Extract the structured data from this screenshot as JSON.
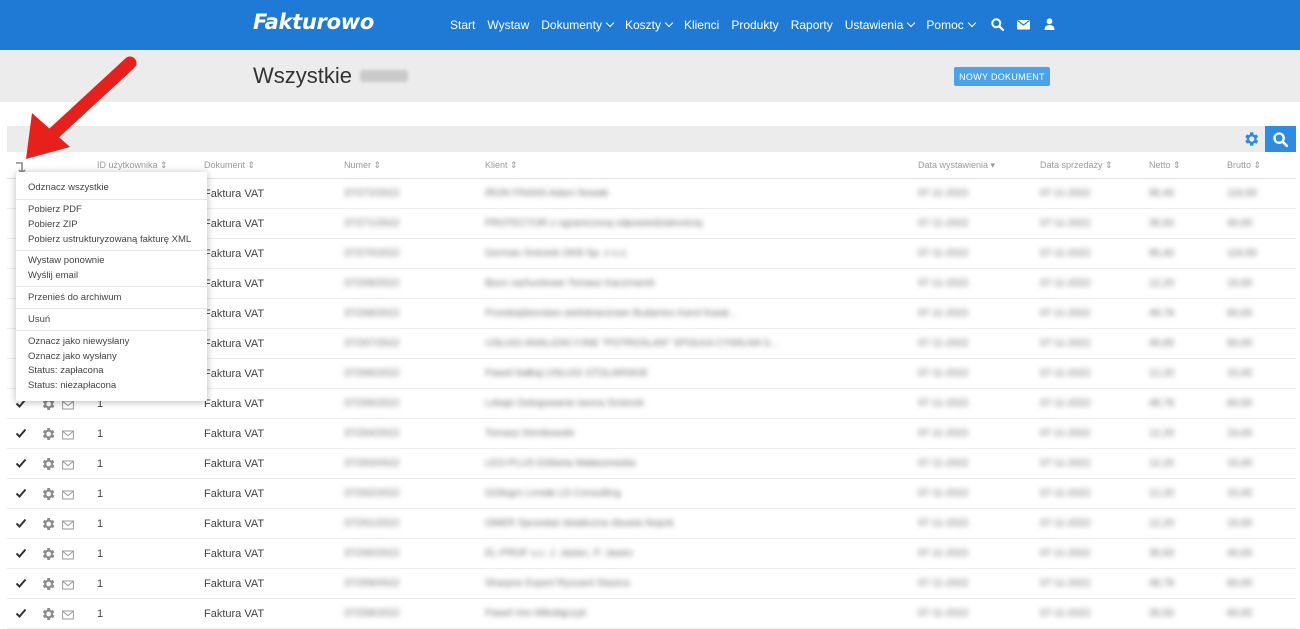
{
  "app": {
    "logo": "Fakturowo",
    "nav": [
      {
        "label": "Start"
      },
      {
        "label": "Wystaw"
      },
      {
        "label": "Dokumenty"
      },
      {
        "label": "Koszty"
      },
      {
        "label": "Klienci"
      },
      {
        "label": "Produkty"
      },
      {
        "label": "Raporty"
      },
      {
        "label": "Ustawienia"
      },
      {
        "label": "Pomoc"
      }
    ]
  },
  "colors": {
    "brand": "#1f7ad6",
    "button": "#4aa3ea",
    "annotation_arrow": "#e8201c"
  },
  "header": {
    "title": "Wszystkie",
    "new_document_label": "NOWY DOKUMENT"
  },
  "table": {
    "columns": [
      "ID użytkownika",
      "Dokument",
      "Numer",
      "Klient",
      "Data wystawienia",
      "Data sprzedaży",
      "Netto",
      "Brutto"
    ],
    "rows": [
      {
        "user_id": "",
        "document": "Faktura VAT",
        "number": "37/272/2022",
        "client": "IRON FRANS Adam Nowak",
        "issue_date": "07-11-2022",
        "sale_date": "07-11-2022",
        "net": "95,40",
        "gross": "116,50"
      },
      {
        "user_id": "",
        "document": "Faktura VAT",
        "number": "37/271/2022",
        "client": "PROTECTOR z ograniczoną odpowiedzialnością",
        "issue_date": "07-11-2022",
        "sale_date": "07-11-2022",
        "net": "35,50",
        "gross": "40,00"
      },
      {
        "user_id": "",
        "document": "Faktura VAT",
        "number": "37/270/2022",
        "client": "German Śnieżek OKB Sp. z o.o.",
        "issue_date": "07-11-2022",
        "sale_date": "07-11-2022",
        "net": "95,40",
        "gross": "116,50"
      },
      {
        "user_id": "",
        "document": "Faktura VAT",
        "number": "37/269/2022",
        "client": "Biuro rachunkowe Tomasz Kaczmarek",
        "issue_date": "07-11-2022",
        "sale_date": "07-11-2022",
        "net": "12,20",
        "gross": "15,00"
      },
      {
        "user_id": "",
        "document": "Faktura VAT",
        "number": "37/268/2022",
        "client": "Przedsiębiorstwo wielobranżowe Budamex Karol Kwiat...",
        "issue_date": "07-11-2022",
        "sale_date": "07-11-2022",
        "net": "48,78",
        "gross": "60,00"
      },
      {
        "user_id": "",
        "document": "Faktura VAT",
        "number": "37/267/2022",
        "client": "USŁUGI ANALIZACYJNE \"POTROSLAN\" SPÓŁKA CYWILNA S...",
        "issue_date": "07-11-2022",
        "sale_date": "07-11-2022",
        "net": "40,65",
        "gross": "50,00"
      },
      {
        "user_id": "",
        "document": "Faktura VAT",
        "number": "37/266/2022",
        "client": "Paweł Nałkaj USŁUGI STOLARSKIE",
        "issue_date": "07-11-2022",
        "sale_date": "07-11-2022",
        "net": "12,20",
        "gross": "15,00"
      },
      {
        "user_id": "1",
        "document": "Faktura VAT",
        "number": "37/265/2022",
        "client": "Lekaje Delegowanie Iwona Śmierek",
        "issue_date": "07-11-2022",
        "sale_date": "07-11-2022",
        "net": "48,78",
        "gross": "60,00"
      },
      {
        "user_id": "1",
        "document": "Faktura VAT",
        "number": "37/264/2022",
        "client": "Tomasz Dembowski",
        "issue_date": "07-11-2022",
        "sale_date": "07-11-2022",
        "net": "12,20",
        "gross": "15,00"
      },
      {
        "user_id": "1",
        "document": "Faktura VAT",
        "number": "37/263/2022",
        "client": "LEO-PLUS Elżbieta Małaszewska",
        "issue_date": "07-11-2022",
        "sale_date": "07-11-2022",
        "net": "12,20",
        "gross": "15,00"
      },
      {
        "user_id": "1",
        "document": "Faktura VAT",
        "number": "37/262/2022",
        "client": "GOlegro Leniak LD Consulting",
        "issue_date": "07-11-2022",
        "sale_date": "07-11-2022",
        "net": "12,20",
        "gross": "15,00"
      },
      {
        "user_id": "1",
        "document": "Faktura VAT",
        "number": "37/261/2022",
        "client": "OMER Sprzedaż detaliczna obuwia Nopok",
        "issue_date": "07-11-2022",
        "sale_date": "07-11-2022",
        "net": "12,20",
        "gross": "15,00"
      },
      {
        "user_id": "1",
        "document": "Faktura VAT",
        "number": "37/260/2022",
        "client": "EL-PROF s.c. J. Jasiec, P. Jasiec",
        "issue_date": "07-11-2022",
        "sale_date": "07-11-2022",
        "net": "35,50",
        "gross": "40,00"
      },
      {
        "user_id": "1",
        "document": "Faktura VAT",
        "number": "37/259/2022",
        "client": "Sharpne Expert Ryszard Stasica",
        "issue_date": "07-11-2022",
        "sale_date": "07-11-2022",
        "net": "48,78",
        "gross": "60,00"
      },
      {
        "user_id": "1",
        "document": "Faktura VAT",
        "number": "37/258/2022",
        "client": "Paweł Von Mikołajczyk",
        "issue_date": "07-11-2022",
        "sale_date": "07-11-2022",
        "net": "35,50",
        "gross": "60,00"
      }
    ]
  },
  "dropdown": {
    "items": [
      {
        "label": "Odznacz wszystkie"
      },
      {
        "label": "Pobierz PDF"
      },
      {
        "label": "Pobierz ZIP"
      },
      {
        "label": "Pobierz ustrukturyzowaną fakturę XML"
      },
      {
        "label": "Wystaw ponownie"
      },
      {
        "label": "Wyślij email"
      },
      {
        "label": "Przenieś do archiwum"
      },
      {
        "label": "Usuń"
      },
      {
        "label": "Oznacz jako niewysłany"
      },
      {
        "label": "Oznacz jako wysłany"
      },
      {
        "label": "Status: zapłacona"
      },
      {
        "label": "Status: niezapłacona"
      }
    ]
  }
}
